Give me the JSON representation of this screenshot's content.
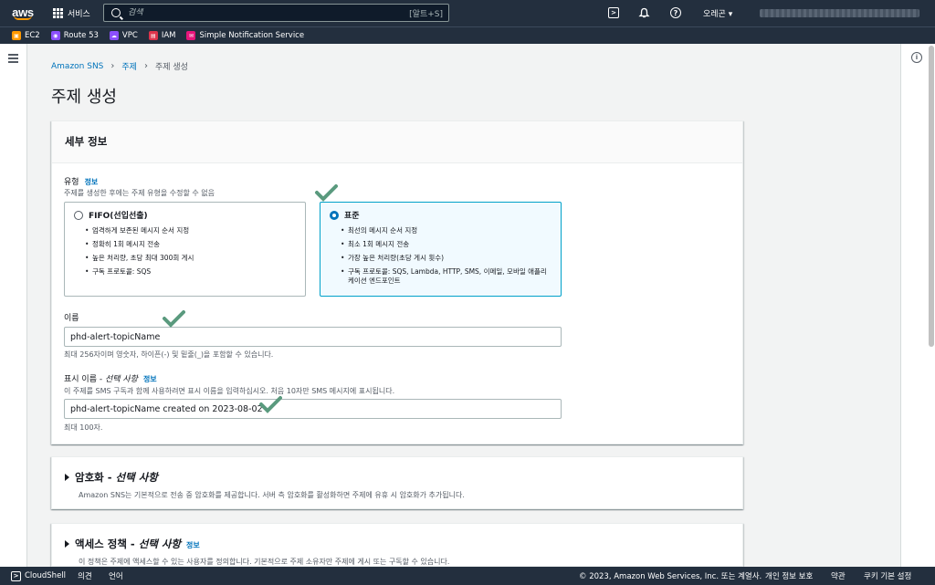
{
  "topnav": {
    "logo_text": "aws",
    "services_label": "서비스",
    "search_placeholder": "검색",
    "search_shortcut": "[알트+S]",
    "region_label": "오레곤 ▾"
  },
  "favorites": [
    {
      "label": "EC2",
      "color": "#ff9900",
      "icon": "ec2-icon"
    },
    {
      "label": "Route 53",
      "color": "#8c4fff",
      "icon": "route53-icon"
    },
    {
      "label": "VPC",
      "color": "#8c4fff",
      "icon": "vpc-icon"
    },
    {
      "label": "IAM",
      "color": "#dd344c",
      "icon": "iam-icon"
    },
    {
      "label": "Simple Notification Service",
      "color": "#e7157b",
      "icon": "sns-icon"
    }
  ],
  "breadcrumb": {
    "items": [
      "Amazon SNS",
      "주제"
    ],
    "current": "주제 생성"
  },
  "page_title": "주제 생성",
  "details": {
    "header": "세부 정보",
    "type_label": "유형",
    "info": "정보",
    "type_desc": "주제를 생성한 후에는 주제 유형을 수정할 수 없음",
    "fifo": {
      "title": "FIFO(선입선출)",
      "bullets": [
        "엄격하게 보존된 메시지 순서 지정",
        "정확히 1회 메시지 전송",
        "높은 처리량, 초당 최대 300회 게시",
        "구독 프로토콜: SQS"
      ]
    },
    "standard": {
      "title": "표준",
      "bullets": [
        "최선의 메시지 순서 지정",
        "최소 1회 메시지 전송",
        "가장 높은 처리량(초당 게시 횟수)",
        "구독 프로토콜: SQS, Lambda, HTTP, SMS, 이메일, 모바일 애플리케이션 엔드포인트"
      ]
    },
    "name_label": "이름",
    "name_value": "phd-alert-topicName",
    "name_desc": "최대 256자이며 영숫자, 하이픈(-) 및 밑줄(_)을 포함할 수 있습니다.",
    "display_label": "표시 이름 - ",
    "display_optional": "선택 사항",
    "display_info": "정보",
    "display_desc": "이 주제를 SMS 구독과 함께 사용하려면 표시 이름을 입력하십시오. 처음 10자만 SMS 메시지에 표시됩니다.",
    "display_value": "phd-alert-topicName created on 2023-08-02",
    "display_limit": "최대 100자."
  },
  "encryption": {
    "title": "암호화 - ",
    "optional": "선택 사항",
    "desc": "Amazon SNS는 기본적으로 전송 중 암호화를 제공합니다. 서버 측 암호화를 활성화하면 주제에 유휴 시 암호화가 추가됩니다."
  },
  "access_policy": {
    "title": "액세스 정책 - ",
    "optional": "선택 사항",
    "info": "정보",
    "desc": "이 정책은 주제에 액세스할 수 있는 사용자를 정의합니다. 기본적으로 주제 소유자만 주제에 게시 또는 구독할 수 있습니다."
  },
  "footer": {
    "cloudshell": "CloudShell",
    "feedback": "의견",
    "language": "언어",
    "copyright": "© 2023, Amazon Web Services, Inc. 또는 계열사.",
    "privacy": "개인 정보 보호",
    "terms": "약관",
    "cookies": "쿠키 기본 설정"
  },
  "colors": {
    "nav_bg": "#232f3e",
    "link": "#0073bb",
    "check": "#5a9a7e"
  }
}
